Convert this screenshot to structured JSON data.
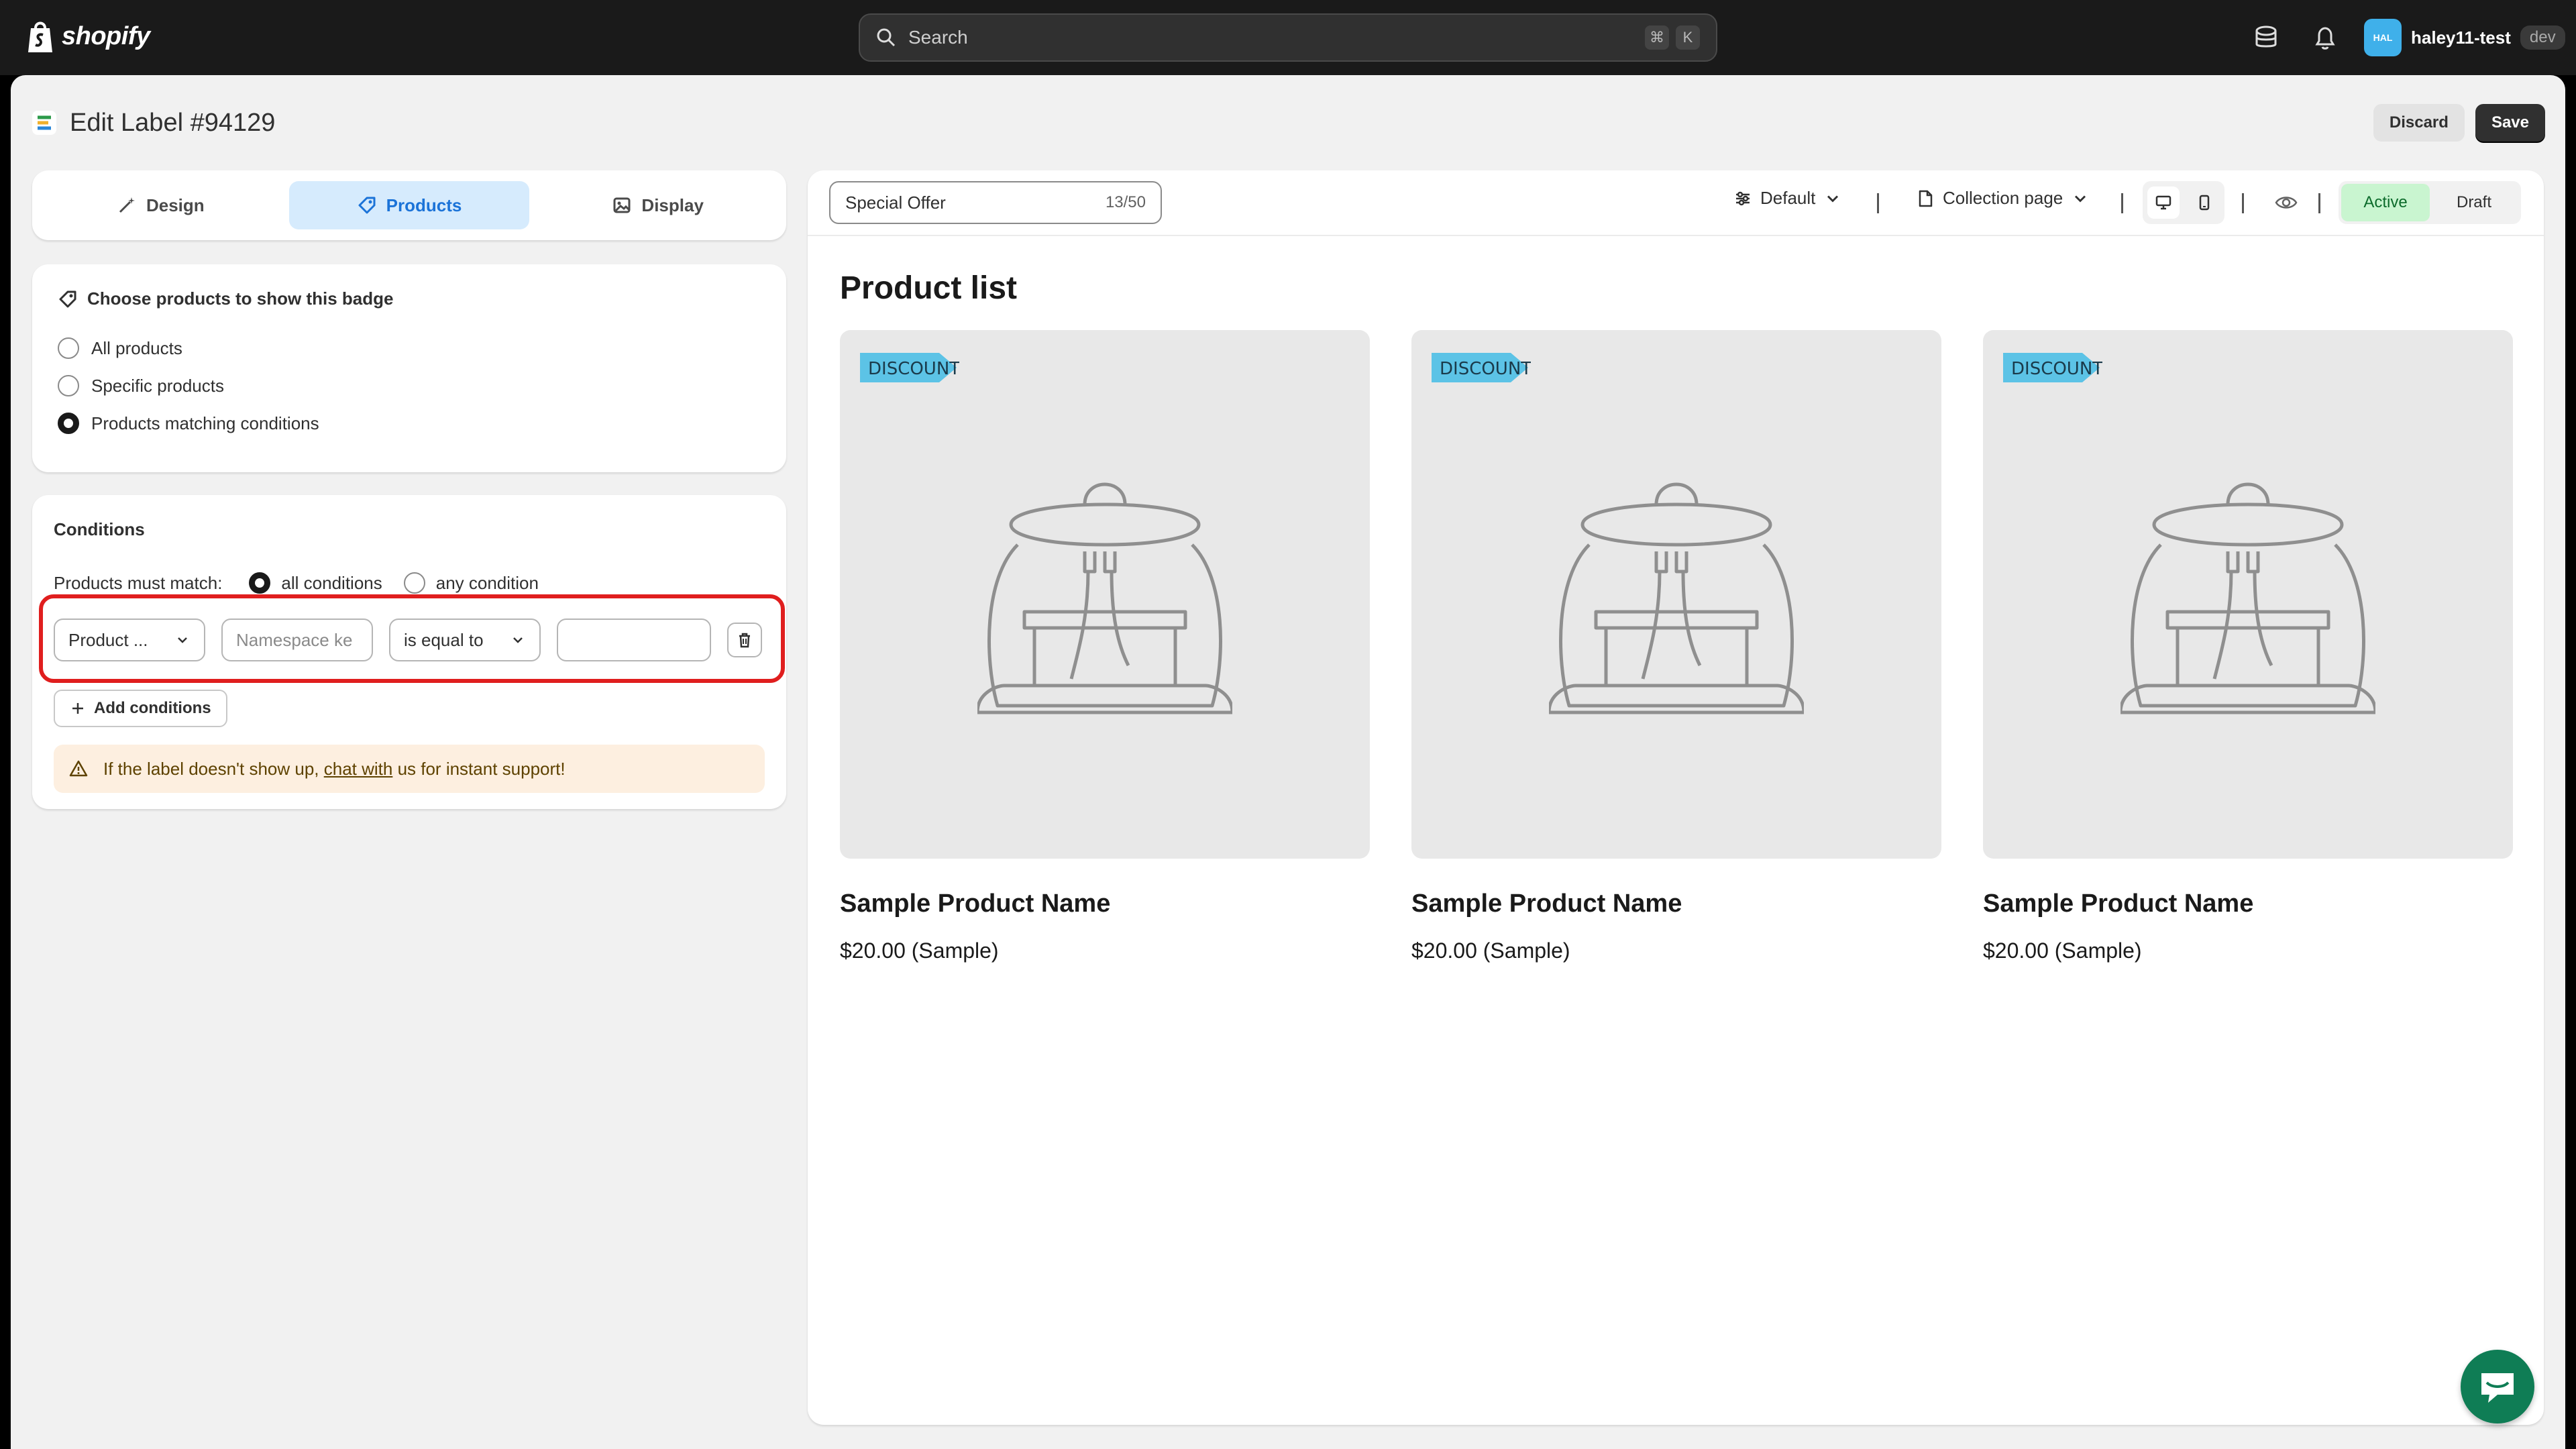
{
  "topbar": {
    "brand": "shopify",
    "search_placeholder": "Search",
    "shortcut_keys": [
      "⌘",
      "K"
    ],
    "avatar_initials": "HAL",
    "store_name": "haley11-test",
    "env_badge": "dev"
  },
  "header": {
    "title": "Edit Label #94129",
    "discard_label": "Discard",
    "save_label": "Save"
  },
  "tabs": [
    {
      "label": "Design",
      "icon": "wand-icon"
    },
    {
      "label": "Products",
      "icon": "tag-icon",
      "active": true
    },
    {
      "label": "Display",
      "icon": "image-icon"
    }
  ],
  "choose": {
    "heading": "Choose products to show this badge",
    "options": [
      "All products",
      "Specific products",
      "Products matching conditions"
    ],
    "selected_index": 2
  },
  "conditions": {
    "title": "Conditions",
    "match_label": "Products must match:",
    "match_options": [
      "all conditions",
      "any condition"
    ],
    "match_selected": 0,
    "row": {
      "field": "Product ...",
      "namespace_placeholder": "Namespace ke",
      "operator": "is equal to",
      "value": ""
    },
    "add_label": "Add conditions",
    "warning_prefix": "If the label doesn't show up, ",
    "warning_link": "chat with",
    "warning_suffix": " us for instant support!"
  },
  "preview": {
    "label_name": "Special Offer",
    "label_count": "13/50",
    "theme": "Default",
    "page": "Collection page",
    "status_options": [
      "Active",
      "Draft"
    ],
    "status_selected": 0,
    "list_title": "Product list",
    "badge_text": "DISCOUNT",
    "products": [
      {
        "name": "Sample Product Name",
        "price": "$20.00 (Sample)"
      },
      {
        "name": "Sample Product Name",
        "price": "$20.00 (Sample)"
      },
      {
        "name": "Sample Product Name",
        "price": "$20.00 (Sample)"
      }
    ]
  },
  "colors": {
    "topbar_bg": "#1a1a1a",
    "active_tab_bg": "#d6ebfd",
    "active_tab_text": "#1b73d8",
    "highlight_border": "#e01e1e",
    "active_status_bg": "#c9f5d0",
    "badge_fill": "#5cc3e6",
    "chat_fab": "#0f7d55"
  }
}
